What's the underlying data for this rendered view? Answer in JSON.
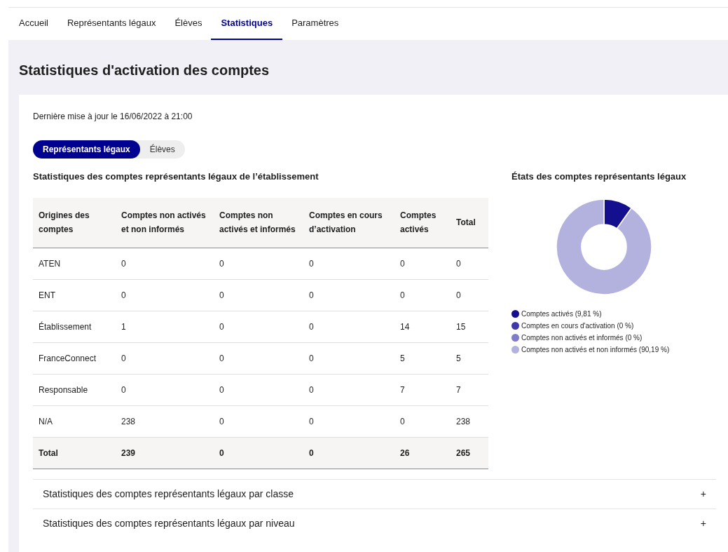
{
  "nav_tabs": [
    {
      "label": "Accueil",
      "selected": false
    },
    {
      "label": "Représentants légaux",
      "selected": false
    },
    {
      "label": "Élèves",
      "selected": false
    },
    {
      "label": "Statistiques",
      "selected": true
    },
    {
      "label": "Paramètres",
      "selected": false
    }
  ],
  "page_title": "Statistiques d'activation des comptes",
  "last_update": "Dernière mise à jour le 16/06/2022 à 21:00",
  "segmented": [
    {
      "label": "Représentants légaux",
      "selected": true
    },
    {
      "label": "Élèves",
      "selected": false
    }
  ],
  "table": {
    "title": "Statistiques des comptes représentants légaux de l’établissement",
    "columns": [
      "Origines des comptes",
      "Comptes non activés et non informés",
      "Comptes non activés et informés",
      "Comptes en cours d’activation",
      "Comptes activés",
      "Total"
    ],
    "rows": [
      {
        "kind": "data",
        "cells": [
          "ATEN",
          "0",
          "0",
          "0",
          "0",
          "0"
        ]
      },
      {
        "kind": "data",
        "cells": [
          "ENT",
          "0",
          "0",
          "0",
          "0",
          "0"
        ]
      },
      {
        "kind": "data",
        "cells": [
          "Établissement",
          "1",
          "0",
          "0",
          "14",
          "15"
        ]
      },
      {
        "kind": "data",
        "cells": [
          "FranceConnect",
          "0",
          "0",
          "0",
          "5",
          "5"
        ]
      },
      {
        "kind": "data",
        "cells": [
          "Responsable",
          "0",
          "0",
          "0",
          "7",
          "7"
        ]
      },
      {
        "kind": "data",
        "cells": [
          "N/A",
          "238",
          "0",
          "0",
          "0",
          "238"
        ]
      },
      {
        "kind": "total",
        "cells": [
          "Total",
          "239",
          "0",
          "0",
          "26",
          "265"
        ]
      }
    ]
  },
  "donut": {
    "chart_data": {
      "type": "donut",
      "title": "États des comptes représentants légaux",
      "categories": [
        "Comptes activés",
        "Comptes en cours d'activation",
        "Comptes non activés et informés",
        "Comptes non activés et non informés"
      ],
      "values": [
        9.81,
        0,
        0,
        90.19
      ]
    },
    "legend": [
      {
        "share": "(9,81 %)",
        "color": "#130f8f"
      },
      {
        "share": "(0 %)",
        "color": "#3d39a8"
      },
      {
        "share": "(0 %)",
        "color": "#7f7cc9"
      },
      {
        "share": "(90,19 %)",
        "color": "#b3b1de"
      }
    ]
  },
  "accordions": [
    {
      "label": "Statistiques des comptes représentants légaux par classe",
      "toggle": "+",
      "expanded": false
    },
    {
      "label": "Statistiques des comptes représentants légaux par niveau",
      "toggle": "+",
      "expanded": false
    }
  ]
}
